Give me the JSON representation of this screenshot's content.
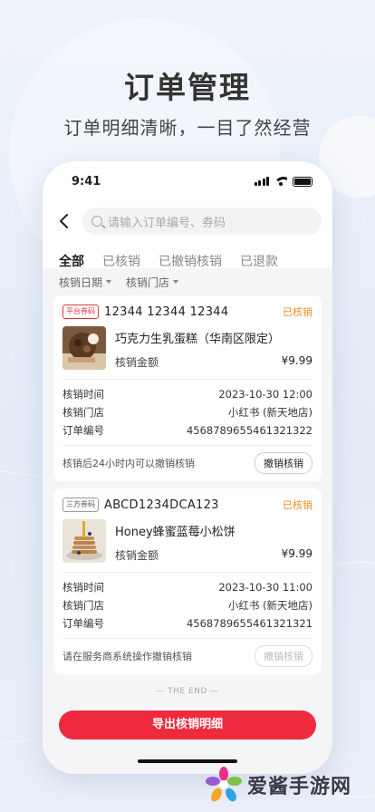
{
  "promo": {
    "title": "订单管理",
    "subtitle": "订单明细清晰，一目了然经营"
  },
  "status_bar": {
    "time": "9:41"
  },
  "search": {
    "placeholder": "请输入订单编号、券码"
  },
  "tabs": [
    {
      "label": "全部",
      "active": true
    },
    {
      "label": "已核销",
      "active": false
    },
    {
      "label": "已撤销核销",
      "active": false
    },
    {
      "label": "已退款",
      "active": false
    }
  ],
  "filters": {
    "date": "核销日期",
    "store": "核销门店"
  },
  "orders": [
    {
      "badge": "平台券码",
      "code": "12344 12344 12344",
      "status": "已核销",
      "product_name": "巧克力生乳蛋糕（华南区限定）",
      "amount_label": "核销金额",
      "amount": "¥9.99",
      "time_label": "核销时间",
      "time": "2023-10-30 12:00",
      "store_label": "核销门店",
      "store": "小红书 (新天地店)",
      "order_label": "订单编号",
      "order_no": "4568789655461321322",
      "note": "核销后24小时内可以撤销核销",
      "action": "撤销核销"
    },
    {
      "badge": "三方券码",
      "code": "ABCD1234DCA123",
      "status": "已核销",
      "product_name": "Honey蜂蜜蓝莓小松饼",
      "amount_label": "核销金额",
      "amount": "¥9.99",
      "time_label": "核销时间",
      "time": "2023-10-30 11:00",
      "store_label": "核销门店",
      "store": "小红书 (新天地店)",
      "order_label": "订单编号",
      "order_no": "4568789655461321321",
      "note": "请在服务商系统操作撤销核销",
      "action": "撤销核销"
    }
  ],
  "end_text": "— THE END —",
  "export_button": "导出核销明细",
  "brand": {
    "name": "爱酱手游网"
  },
  "colors": {
    "accent": "#ee2a3f",
    "status": "#f58a1e"
  }
}
